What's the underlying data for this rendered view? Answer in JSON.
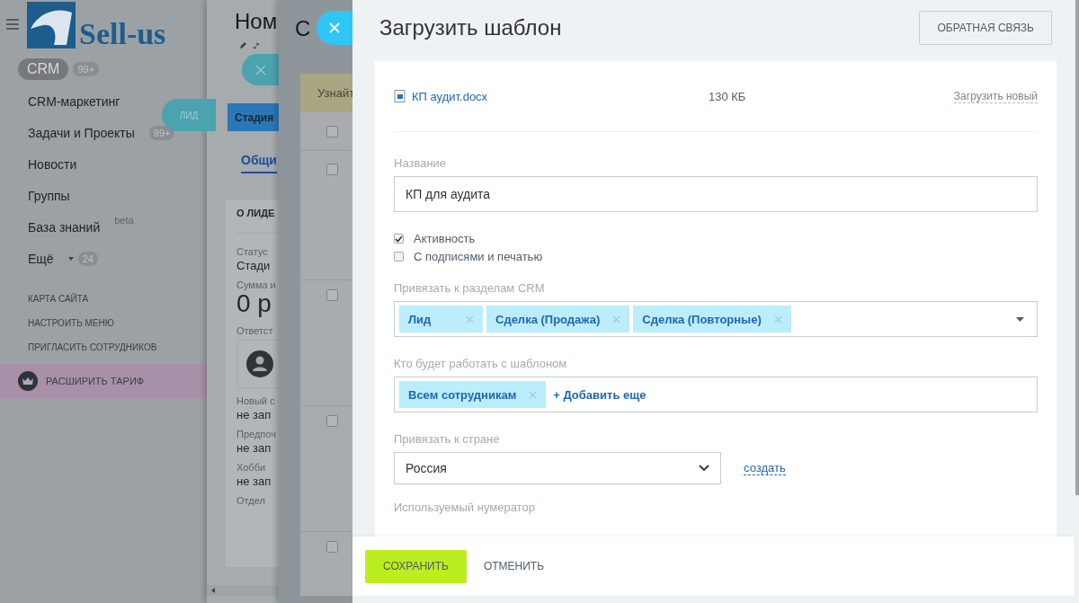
{
  "sidebar": {
    "logo_text": "Sell-us",
    "items": [
      {
        "label": "CRM",
        "badge": "99+",
        "selected": true
      },
      {
        "label": "CRM-маркетинг",
        "selected": false
      },
      {
        "label": "Задачи и Проекты",
        "badge": "99+",
        "selected": false
      },
      {
        "label": "Новости",
        "selected": false
      },
      {
        "label": "Группы",
        "selected": false
      },
      {
        "label": "База знаний",
        "note": "beta",
        "selected": false
      },
      {
        "label": "Ещё",
        "badge": "24",
        "dropdown": true,
        "selected": false
      }
    ],
    "links": [
      "КАРТА САЙТА",
      "НАСТРОИТЬ МЕНЮ",
      "ПРИГЛАСИТЬ СОТРУДНИКОВ"
    ],
    "upgrade": "РАСШИРИТЬ ТАРИФ"
  },
  "lead_page": {
    "title": "Ном",
    "tag": "ЛИД",
    "stage_button": "Стадия",
    "tabs": [
      {
        "label": "Общи",
        "selected": true
      }
    ],
    "section_title": "О ЛИДЕ",
    "fields": [
      {
        "kind": "text",
        "label": "Статус",
        "value": "Стади"
      },
      {
        "kind": "amount",
        "label": "Сумма и",
        "value": "0 р"
      },
      {
        "kind": "user",
        "label": "Ответст"
      },
      {
        "kind": "text",
        "label": "Новый с",
        "value": "не зап"
      },
      {
        "kind": "text",
        "label": "Предпоч",
        "value": "не зап"
      },
      {
        "kind": "text",
        "label": "Хобби",
        "value": "не зап"
      },
      {
        "kind": "text",
        "label": "Отдел"
      }
    ]
  },
  "list_page": {
    "title": "С",
    "banner": "Узнайт",
    "rows": [
      {
        "checked": false
      },
      {
        "checked": false
      },
      {
        "checked": false
      },
      {
        "checked": false
      },
      {
        "checked": false
      }
    ]
  },
  "slider": {
    "title": "Загрузить шаблон",
    "feedback_button": "ОБРАТНАЯ СВЯЗЬ",
    "file": {
      "name": "КП аудит.docx",
      "size": "130 КБ",
      "action": "Загрузить новый"
    },
    "name_field": {
      "label": "Название",
      "value": "КП для аудита"
    },
    "checkboxes": [
      {
        "label": "Активность",
        "checked": true
      },
      {
        "label": "С подписями и печатью",
        "checked": false
      }
    ],
    "crm_sections": {
      "label": "Привязать к разделам CRM",
      "tags": [
        "Лид",
        "Сделка (Продажа)",
        "Сделка (Повторные)"
      ]
    },
    "users": {
      "label": "Кто будет работать с шаблоном",
      "tags": [
        "Всем сотрудникам"
      ],
      "add_link": "+ Добавить еще"
    },
    "country": {
      "label": "Привязать к стране",
      "value": "Россия",
      "create_link": "создать"
    },
    "numerator": {
      "label": "Используемый нумератор"
    },
    "buttons": {
      "save": "СОХРАНИТЬ",
      "cancel": "ОТМЕНИТЬ"
    }
  }
}
